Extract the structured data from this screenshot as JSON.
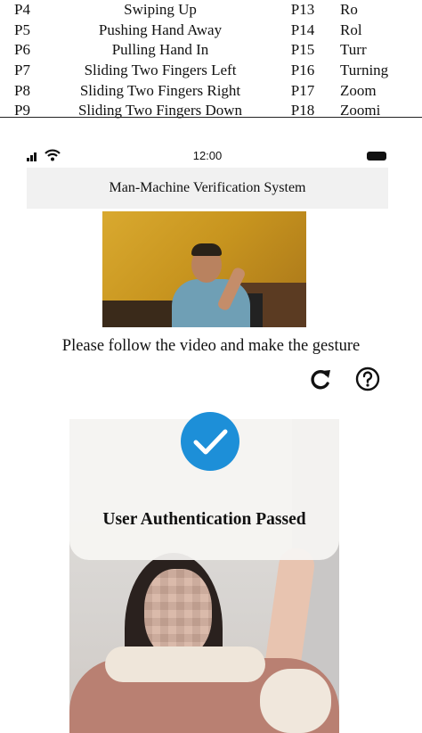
{
  "gesture_table": {
    "rows": [
      {
        "id1": "P4",
        "name1": "Swiping Up",
        "id2": "P13",
        "name2": "Ro"
      },
      {
        "id1": "P5",
        "name1": "Pushing Hand Away",
        "id2": "P14",
        "name2": "Rol"
      },
      {
        "id1": "P6",
        "name1": "Pulling Hand In",
        "id2": "P15",
        "name2": "Turr"
      },
      {
        "id1": "P7",
        "name1": "Sliding Two Fingers Left",
        "id2": "P16",
        "name2": "Turning"
      },
      {
        "id1": "P8",
        "name1": "Sliding Two Fingers Right",
        "id2": "P17",
        "name2": "Zoom"
      },
      {
        "id1": "P9",
        "name1": "Sliding Two Fingers Down",
        "id2": "P18",
        "name2": "Zoomi"
      }
    ]
  },
  "phone": {
    "status_bar": {
      "time": "12:00",
      "signal_icon": "signal-bars-icon",
      "wifi_icon": "wifi-icon",
      "battery_icon": "battery-icon"
    },
    "header_title": "Man-Machine Verification System",
    "instruction": "Please follow the video and make the gesture",
    "controls": {
      "refresh_icon": "refresh-icon",
      "help_icon": "help-icon"
    },
    "result": {
      "text": "User Authentication Passed",
      "icon": "checkmark-icon",
      "accent": "#1d8fd8"
    }
  }
}
